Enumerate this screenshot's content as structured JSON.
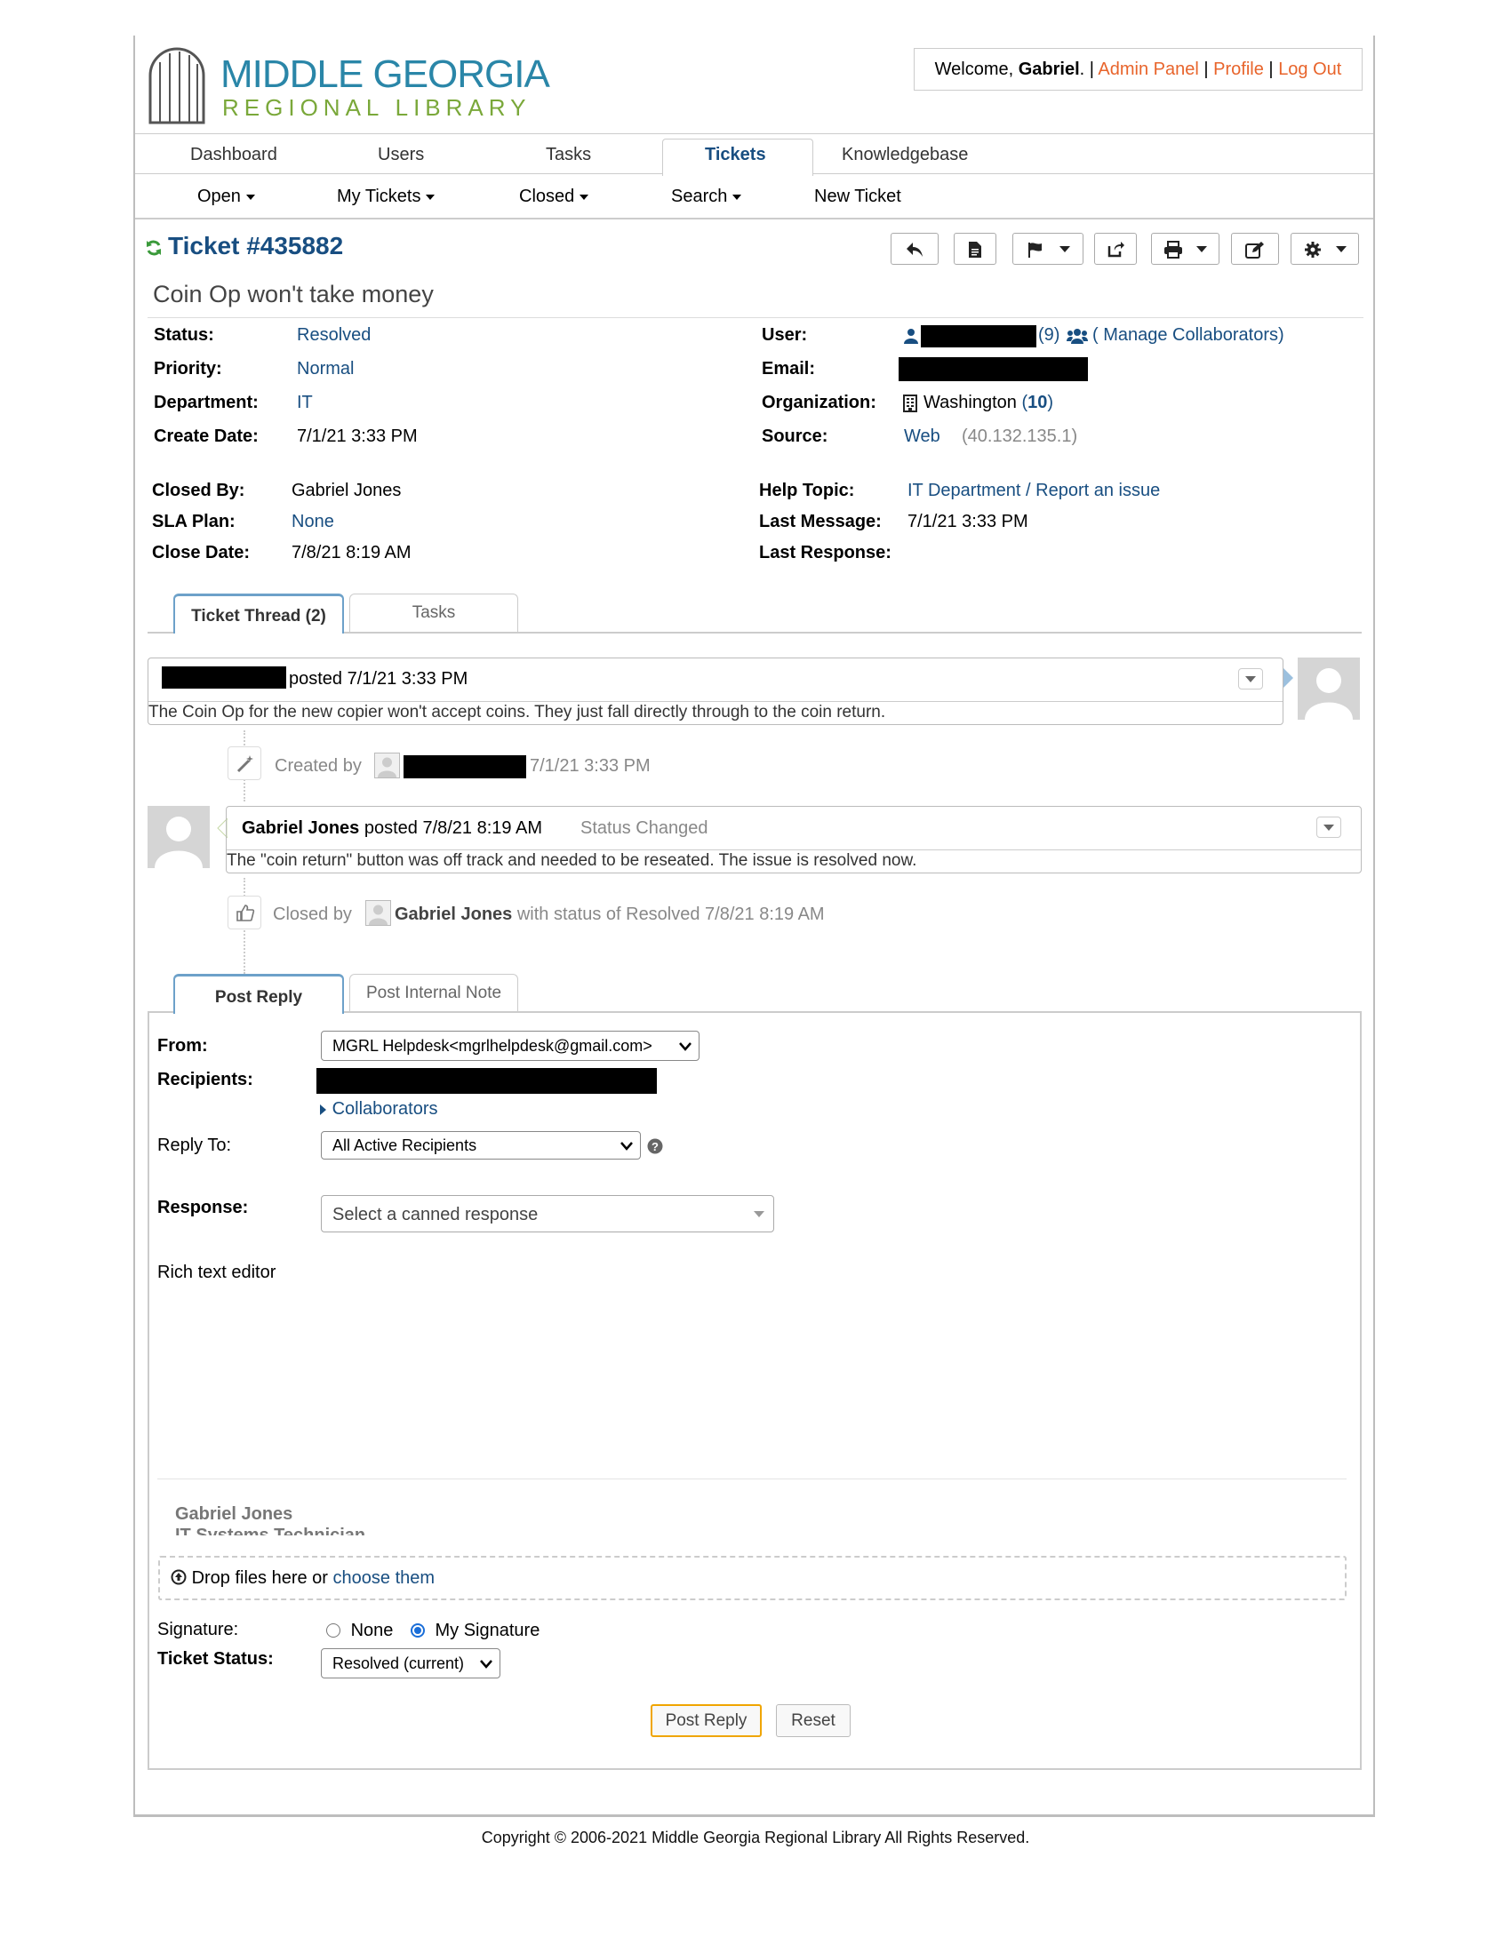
{
  "header": {
    "logo_line1": "MIDDLE GEORGIA",
    "logo_line2": "REGIONAL LIBRARY",
    "welcome_prefix": "Welcome, ",
    "welcome_name": "Gabriel",
    "welcome_suffix": ". |",
    "admin_panel": "Admin Panel",
    "sep": "|",
    "profile": "Profile",
    "logout": "Log Out"
  },
  "nav": {
    "tabs": [
      "Dashboard",
      "Users",
      "Tasks",
      "Tickets",
      "Knowledgebase"
    ],
    "active": "Tickets",
    "sub": [
      "Open",
      "My Tickets",
      "Closed",
      "Search",
      "New Ticket"
    ]
  },
  "ticket": {
    "number": "Ticket #435882",
    "subject": "Coin Op won't take money",
    "left": [
      {
        "label": "Status:",
        "value": "Resolved"
      },
      {
        "label": "Priority:",
        "value": "Normal"
      },
      {
        "label": "Department:",
        "value": "IT"
      },
      {
        "label": "Create Date:",
        "value": "7/1/21 3:33 PM"
      }
    ],
    "right": {
      "user_label": "User:",
      "user_count": "(9)",
      "manage_collaborators": "( Manage Collaborators)",
      "email_label": "Email:",
      "org_label": "Organization:",
      "org_name": "Washington",
      "org_count_open": "(",
      "org_count": "10",
      "org_count_close": ")",
      "source_label": "Source:",
      "source_value": "Web",
      "source_ip": "(40.132.135.1)"
    },
    "closed": [
      {
        "label": "Closed By:",
        "value": "Gabriel Jones"
      },
      {
        "label": "SLA Plan:",
        "value": "None"
      },
      {
        "label": "Close Date:",
        "value": "7/8/21 8:19 AM"
      }
    ],
    "closed_right": [
      {
        "label": "Help Topic:",
        "value": "IT Department / Report an issue"
      },
      {
        "label": "Last Message:",
        "value": "7/1/21 3:33 PM"
      },
      {
        "label": "Last Response:",
        "value": ""
      }
    ]
  },
  "thread_tabs": {
    "thread": "Ticket Thread (2)",
    "tasks": "Tasks"
  },
  "thread": {
    "entry1_posted": "posted 7/1/21 3:33 PM",
    "entry1_body": "The Coin Op for the new copier won't accept coins. They just fall directly through to the coin return.",
    "event1_prefix": "Created by",
    "event1_time": "7/1/21 3:33 PM",
    "entry2_author": "Gabriel Jones",
    "entry2_posted": " posted 7/8/21 8:19 AM",
    "entry2_status": "Status Changed",
    "entry2_body": "The \"coin return\" button was off track and needed to be reseated. The issue is resolved now.",
    "event2_prefix": "Closed by",
    "event2_author": "Gabriel Jones",
    "event2_suffix": "with status of Resolved 7/8/21 8:19 AM"
  },
  "reply_tabs": {
    "post_reply": "Post Reply",
    "internal_note": "Post Internal Note"
  },
  "reply": {
    "from_label": "From:",
    "from_value": "MGRL Helpdesk<mgrlhelpdesk@gmail.com>",
    "recipients_label": "Recipients:",
    "collaborators": "Collaborators",
    "reply_to_label": "Reply To:",
    "reply_to_value": "All Active Recipients",
    "response_label": "Response:",
    "response_placeholder": "Select a canned response",
    "editor_label": "Rich text editor",
    "signature_name": "Gabriel Jones",
    "signature_title": "IT Systems Technician",
    "drop_text": "Drop files here or",
    "choose_them": "choose them",
    "signature_label": "Signature:",
    "sig_none": "None",
    "sig_mine": "My Signature",
    "status_label": "Ticket Status:",
    "status_value": "Resolved (current)",
    "post_button": "Post Reply",
    "reset_button": "Reset"
  },
  "footer": "Copyright © 2006-2021 Middle Georgia Regional Library All Rights Reserved.",
  "colors": {
    "link": "#184e81",
    "orange": "#e8642b",
    "logo_blue": "#2a86a8",
    "logo_green": "#7aa83a",
    "post_outline": "#f0a500"
  }
}
